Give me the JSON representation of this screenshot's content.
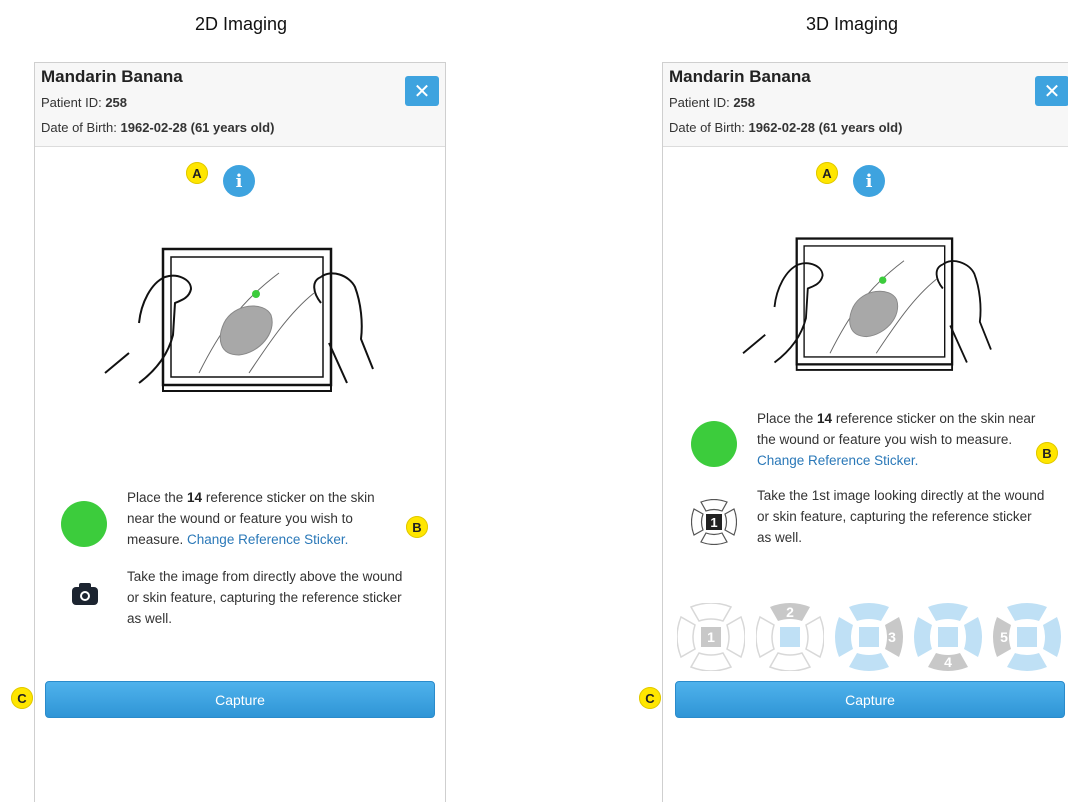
{
  "sections": [
    {
      "title": "2D Imaging",
      "patient": {
        "name": "Mandarin Banana",
        "id_label": "Patient ID:",
        "id_value": "258",
        "dob_label": "Date of Birth:",
        "dob_value": "1962-02-28 (61 years old)"
      },
      "close_glyph": "✕",
      "info_glyph": "i",
      "markers": {
        "a": "A",
        "b": "B",
        "c": "C"
      },
      "instruction_sticker": {
        "pre": "Place the ",
        "number": "14",
        "post": " reference sticker on the skin near the wound or feature you wish to measure. ",
        "link": "Change Reference Sticker."
      },
      "instruction_capture": "Take the image from directly above the wound or skin feature, capturing the reference sticker as well.",
      "capture_label": "Capture",
      "icons": {
        "info": "info-icon",
        "close": "close-icon",
        "camera": "camera-icon",
        "sticker": "green-reference-sticker"
      }
    },
    {
      "title": "3D Imaging",
      "patient": {
        "name": "Mandarin Banana",
        "id_label": "Patient ID:",
        "id_value": "258",
        "dob_label": "Date of Birth:",
        "dob_value": "1962-02-28 (61 years old)"
      },
      "close_glyph": "✕",
      "info_glyph": "i",
      "markers": {
        "a": "A",
        "b": "B",
        "c": "C"
      },
      "instruction_sticker": {
        "pre": "Place the ",
        "number": "14",
        "post": " reference sticker on the skin near the wound or feature you wish to measure. ",
        "link": "Change Reference Sticker."
      },
      "instruction_capture": "Take the 1st image looking directly at the wound or skin feature, capturing the reference sticker as well.",
      "current_step_number": "1",
      "steps": [
        "1",
        "2",
        "3",
        "4",
        "5"
      ],
      "capture_label": "Capture",
      "icons": {
        "info": "info-icon",
        "close": "close-icon",
        "step": "capture-angle-icon",
        "sticker": "green-reference-sticker"
      }
    }
  ],
  "colors": {
    "accent": "#3ea3df",
    "sticker": "#3ccc3c",
    "marker": "#ffe600",
    "link": "#2a78b8",
    "step_done": "#c8c8c8",
    "step_pending": "#bfe0f5"
  }
}
